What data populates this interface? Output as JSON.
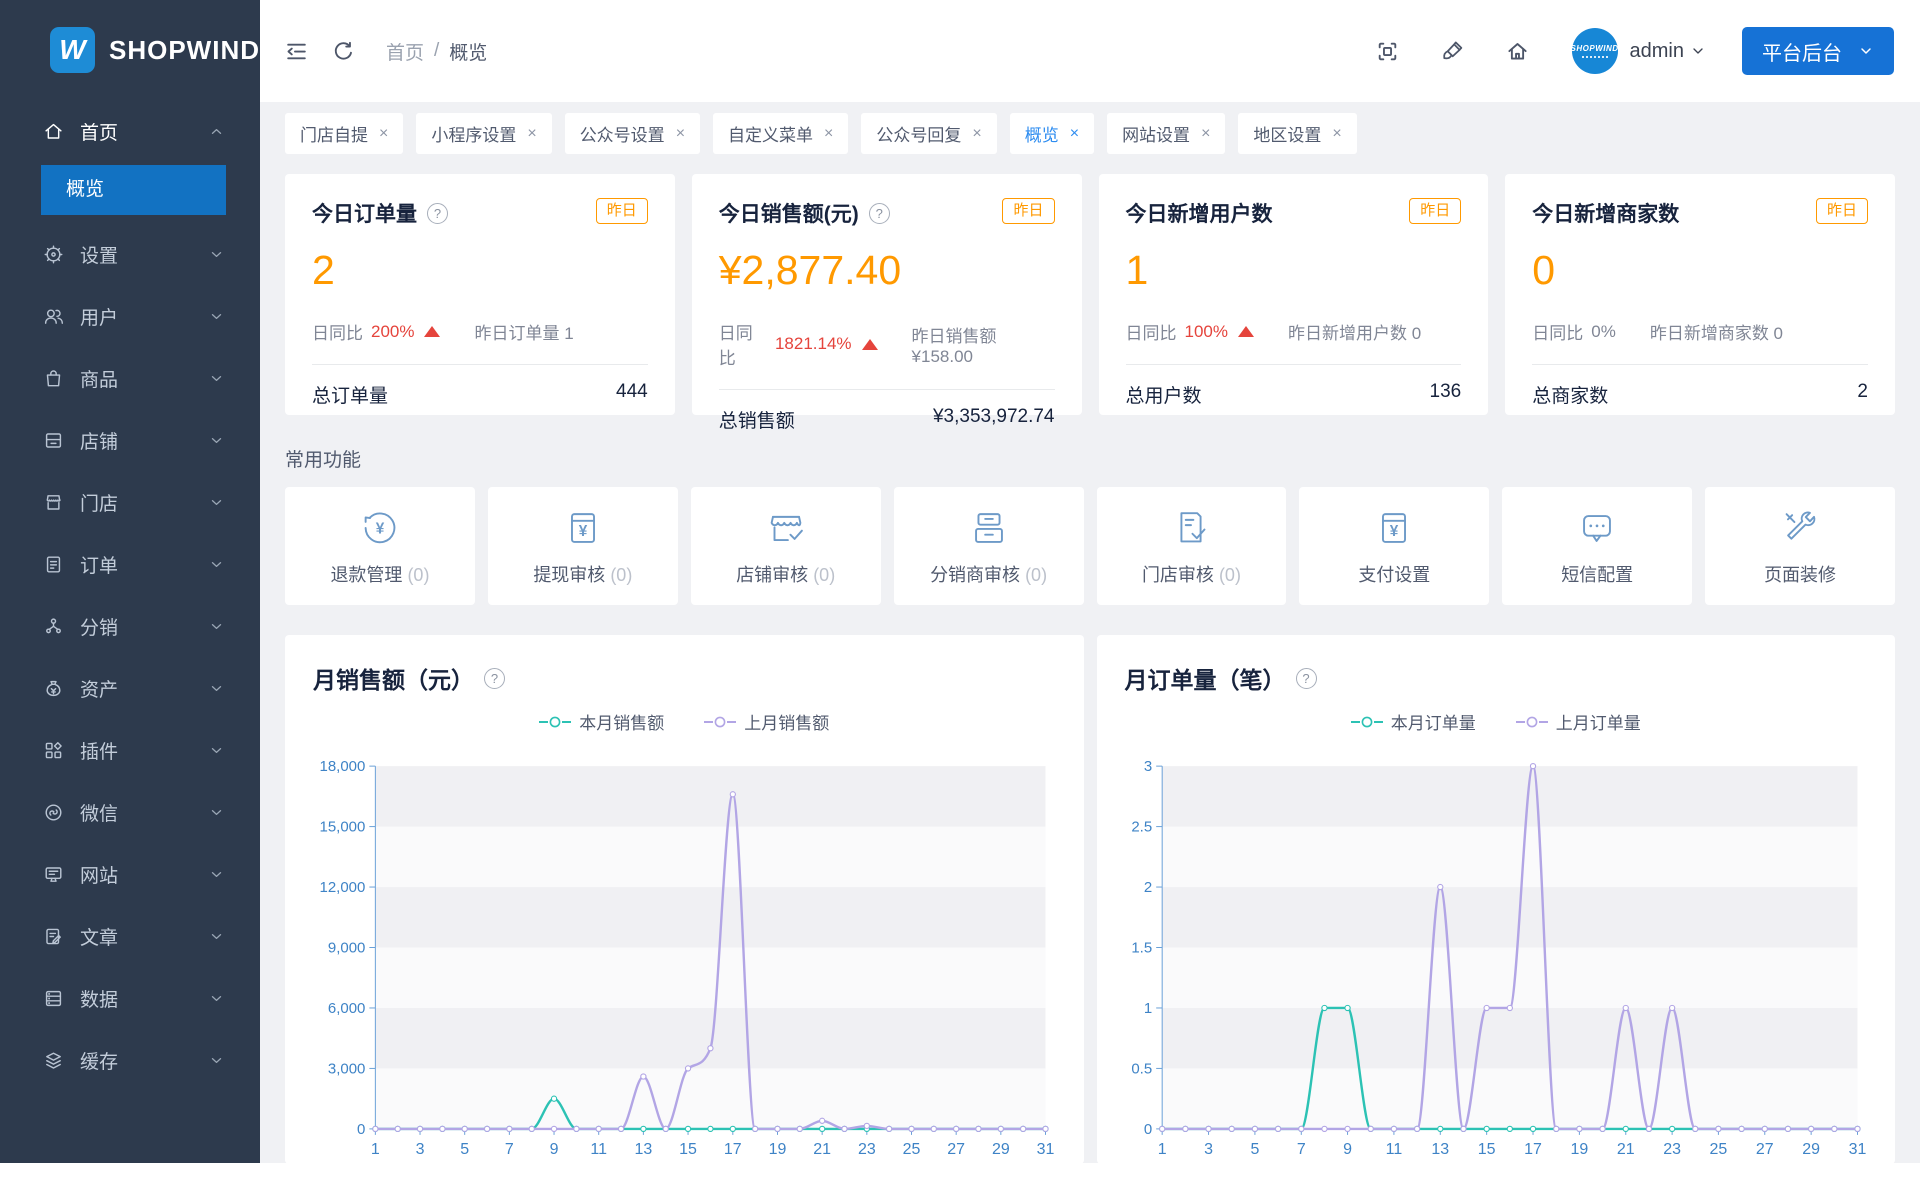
{
  "app": {
    "name": "SHOPWIND",
    "logo_letter": "W"
  },
  "sidebar": {
    "items": [
      {
        "label": "首页",
        "icon": "home",
        "expanded": true
      },
      {
        "label": "设置",
        "icon": "gear"
      },
      {
        "label": "用户",
        "icon": "users"
      },
      {
        "label": "商品",
        "icon": "goods"
      },
      {
        "label": "店铺",
        "icon": "shop"
      },
      {
        "label": "门店",
        "icon": "storefront"
      },
      {
        "label": "订单",
        "icon": "order"
      },
      {
        "label": "分销",
        "icon": "distribution"
      },
      {
        "label": "资产",
        "icon": "assets"
      },
      {
        "label": "插件",
        "icon": "plugin"
      },
      {
        "label": "微信",
        "icon": "wechat"
      },
      {
        "label": "网站",
        "icon": "website"
      },
      {
        "label": "文章",
        "icon": "article"
      },
      {
        "label": "数据",
        "icon": "data"
      },
      {
        "label": "缓存",
        "icon": "cache"
      }
    ],
    "active_submenu": "概览"
  },
  "header": {
    "breadcrumb": [
      "首页",
      "概览"
    ],
    "username": "admin",
    "workspace_button": "平台后台",
    "avatar_text": "SHOPWIND"
  },
  "tabs": [
    {
      "label": "门店自提"
    },
    {
      "label": "小程序设置"
    },
    {
      "label": "公众号设置"
    },
    {
      "label": "自定义菜单"
    },
    {
      "label": "公众号回复"
    },
    {
      "label": "概览",
      "active": true
    },
    {
      "label": "网站设置"
    },
    {
      "label": "地区设置"
    }
  ],
  "stats": [
    {
      "title": "今日订单量",
      "badge": "昨日",
      "value": "2",
      "compare": {
        "label": "日同比",
        "value": "200%",
        "trend": "up"
      },
      "yesterday": "昨日订单量 1",
      "total_label": "总订单量",
      "total_value": "444"
    },
    {
      "title": "今日销售额(元)",
      "badge": "昨日",
      "value": "¥2,877.40",
      "compare": {
        "label": "日同比",
        "value": "1821.14%",
        "trend": "up"
      },
      "yesterday": "昨日销售额 ¥158.00",
      "total_label": "总销售额",
      "total_value": "¥3,353,972.74"
    },
    {
      "title": "今日新增用户数",
      "badge": "昨日",
      "value": "1",
      "compare": {
        "label": "日同比",
        "value": "100%",
        "trend": "up"
      },
      "yesterday": "昨日新增用户数 0",
      "total_label": "总用户数",
      "total_value": "136"
    },
    {
      "title": "今日新增商家数",
      "badge": "昨日",
      "value": "0",
      "compare": {
        "label": "日同比",
        "value": "0%",
        "trend": "flat"
      },
      "yesterday": "昨日新增商家数 0",
      "total_label": "总商家数",
      "total_value": "2"
    }
  ],
  "quick_actions": {
    "section_title": "常用功能",
    "items": [
      {
        "label": "退款管理",
        "count": "(0)",
        "icon": "refund"
      },
      {
        "label": "提现审核",
        "count": "(0)",
        "icon": "withdraw"
      },
      {
        "label": "店铺审核",
        "count": "(0)",
        "icon": "shop-audit"
      },
      {
        "label": "分销商审核",
        "count": "(0)",
        "icon": "distributor-audit"
      },
      {
        "label": "门店审核",
        "count": "(0)",
        "icon": "store-audit"
      },
      {
        "label": "支付设置",
        "count": "",
        "icon": "payment"
      },
      {
        "label": "短信配置",
        "count": "",
        "icon": "sms"
      },
      {
        "label": "页面装修",
        "count": "",
        "icon": "decorate"
      }
    ]
  },
  "chart_data": [
    {
      "type": "line",
      "title": "月销售额（元）",
      "xlabel": "",
      "ylabel": "",
      "x": [
        1,
        2,
        3,
        4,
        5,
        6,
        7,
        8,
        9,
        10,
        11,
        12,
        13,
        14,
        15,
        16,
        17,
        18,
        19,
        20,
        21,
        22,
        23,
        24,
        25,
        26,
        27,
        28,
        29,
        30,
        31
      ],
      "x_label_step": 2,
      "ylim": [
        0,
        18000
      ],
      "ytick_step": 3000,
      "grid": true,
      "legend_position": "top",
      "axis_color": "#6aa1d8",
      "tick_label_color": "#3e83c6",
      "series": [
        {
          "name": "本月销售额",
          "color": "#2cc2b4",
          "values": [
            0,
            0,
            0,
            0,
            0,
            0,
            0,
            0,
            1500,
            0,
            0,
            0,
            0,
            0,
            0,
            0,
            0,
            0,
            0,
            0,
            0,
            0,
            0,
            0,
            0,
            0,
            0,
            0,
            0,
            0,
            0
          ]
        },
        {
          "name": "上月销售额",
          "color": "#b2a5e5",
          "values": [
            0,
            0,
            0,
            0,
            0,
            0,
            0,
            0,
            0,
            0,
            0,
            0,
            2600,
            0,
            3000,
            4000,
            16600,
            0,
            0,
            0,
            400,
            0,
            150,
            0,
            0,
            0,
            0,
            0,
            0,
            0,
            0
          ]
        }
      ]
    },
    {
      "type": "line",
      "title": "月订单量（笔）",
      "xlabel": "",
      "ylabel": "",
      "x": [
        1,
        2,
        3,
        4,
        5,
        6,
        7,
        8,
        9,
        10,
        11,
        12,
        13,
        14,
        15,
        16,
        17,
        18,
        19,
        20,
        21,
        22,
        23,
        24,
        25,
        26,
        27,
        28,
        29,
        30,
        31
      ],
      "x_label_step": 2,
      "ylim": [
        0,
        3
      ],
      "ytick_step": 0.5,
      "grid": true,
      "legend_position": "top",
      "axis_color": "#6aa1d8",
      "tick_label_color": "#3e83c6",
      "series": [
        {
          "name": "本月订单量",
          "color": "#2cc2b4",
          "values": [
            0,
            0,
            0,
            0,
            0,
            0,
            0,
            1,
            1,
            0,
            0,
            0,
            0,
            0,
            0,
            0,
            0,
            0,
            0,
            0,
            0,
            0,
            0,
            0,
            0,
            0,
            0,
            0,
            0,
            0,
            0
          ]
        },
        {
          "name": "上月订单量",
          "color": "#b2a5e5",
          "values": [
            0,
            0,
            0,
            0,
            0,
            0,
            0,
            0,
            0,
            0,
            0,
            0,
            2,
            0,
            1,
            1,
            3,
            0,
            0,
            0,
            1,
            0,
            1,
            0,
            0,
            0,
            0,
            0,
            0,
            0,
            0
          ]
        }
      ]
    }
  ]
}
